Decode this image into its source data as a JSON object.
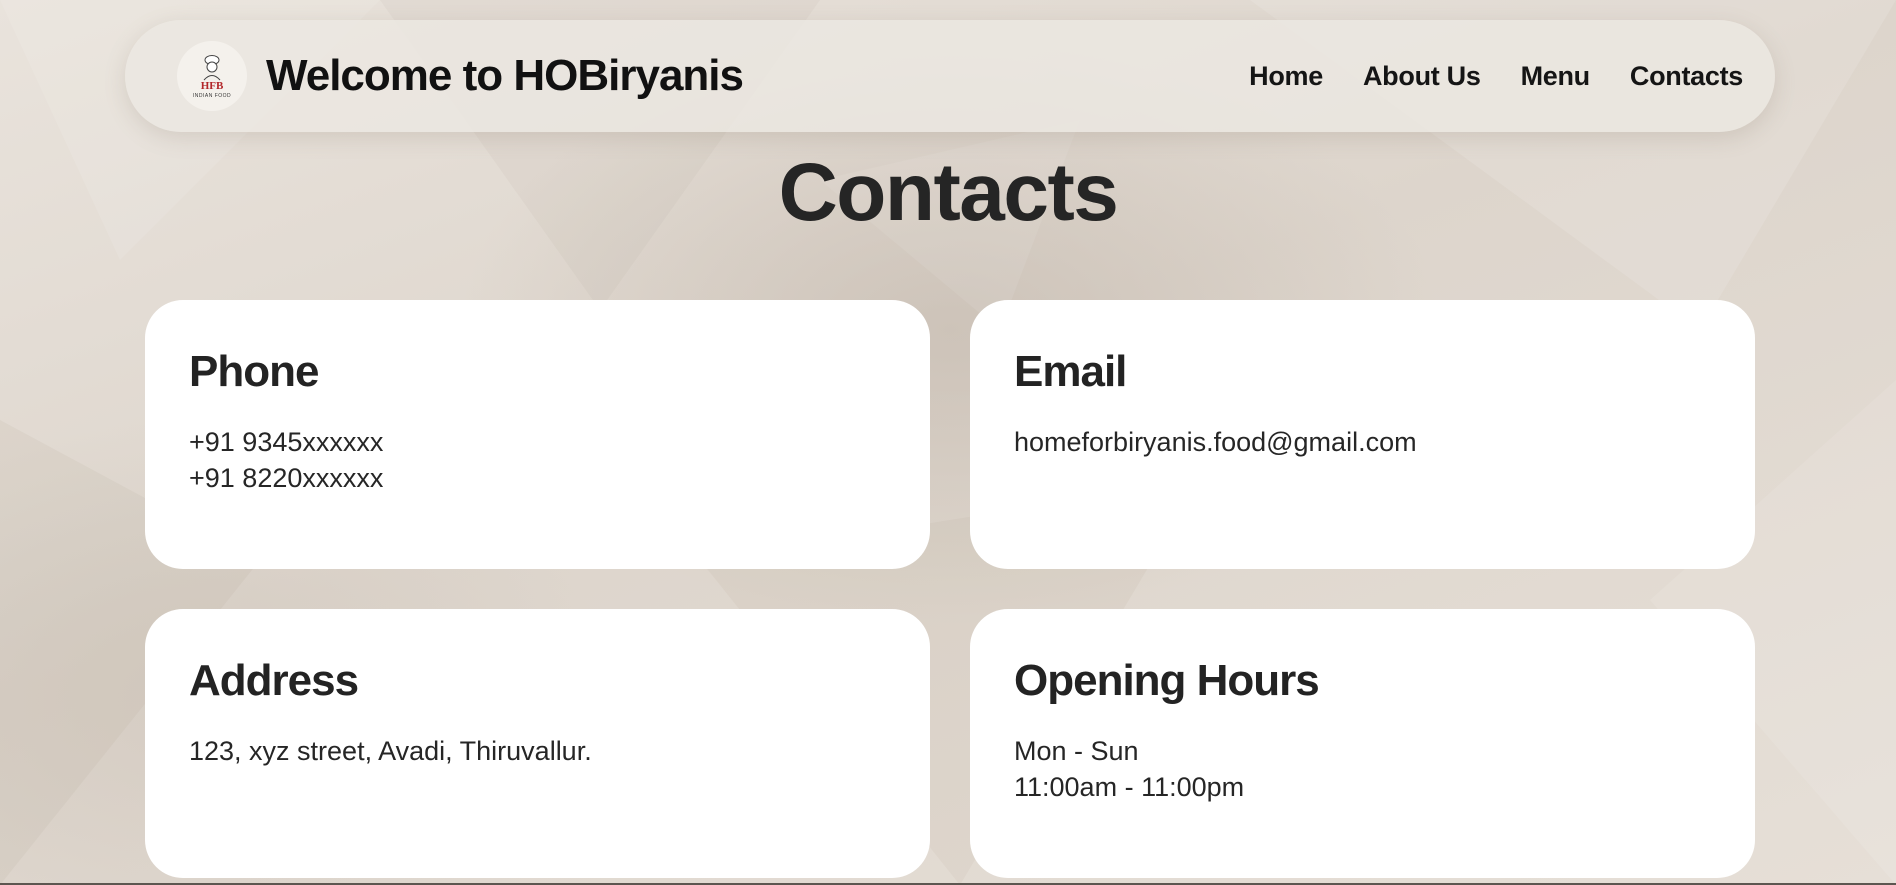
{
  "header": {
    "logo_alt": "HFB logo",
    "logo_caption": "INDIAN FOOD",
    "title": "Welcome to HOBiryanis",
    "nav": [
      {
        "label": "Home"
      },
      {
        "label": "About Us"
      },
      {
        "label": "Menu"
      },
      {
        "label": "Contacts"
      }
    ]
  },
  "page": {
    "heading": "Contacts"
  },
  "cards": {
    "phone": {
      "title": "Phone",
      "lines": [
        "+91 9345xxxxxx",
        "+91 8220xxxxxx"
      ]
    },
    "email": {
      "title": "Email",
      "lines": [
        "homeforbiryanis.food@gmail.com"
      ]
    },
    "address": {
      "title": "Address",
      "lines": [
        "123, xyz street, Avadi, Thiruvallur."
      ]
    },
    "hours": {
      "title": "Opening Hours",
      "lines": [
        "Mon - Sun",
        "11:00am - 11:00pm"
      ]
    }
  },
  "colors": {
    "background": "#e4ddd5",
    "card": "#ffffff",
    "text": "#1f1f1f",
    "logo_accent": "#b2272a"
  }
}
